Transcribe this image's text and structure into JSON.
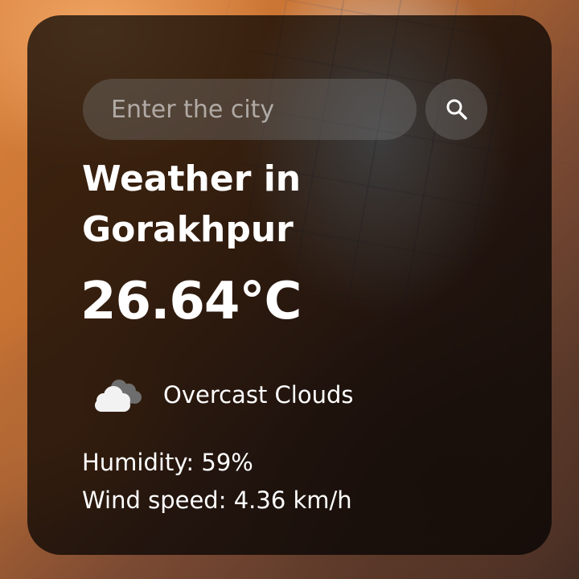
{
  "search": {
    "placeholder": "Enter the city",
    "value": ""
  },
  "weather": {
    "heading": "Weather in Gorakhpur",
    "temperature": "26.64°C",
    "condition": "Overcast Clouds",
    "condition_icon": "overcast-clouds-icon",
    "humidity": "Humidity: 59%",
    "wind": "Wind speed: 4.36 km/h"
  },
  "colors": {
    "card_background": "rgba(0,0,0,0.72)",
    "text": "#ffffff",
    "input_background": "rgba(125,125,125,0.35)"
  }
}
